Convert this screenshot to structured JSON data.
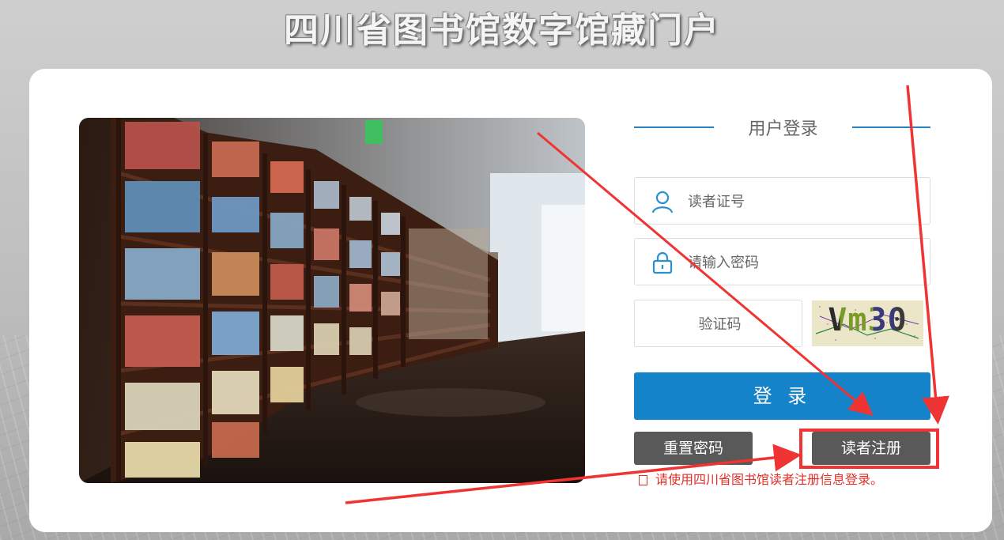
{
  "header": {
    "title": "四川省图书馆数字馆藏门户"
  },
  "login": {
    "heading": "用户登录",
    "reader_id_placeholder": "读者证号",
    "password_placeholder": "请输入密码",
    "captcha_placeholder": "验证码",
    "captcha_image_text": "Vm30",
    "login_button": "登 录",
    "reset_button": "重置密码",
    "register_button": "读者注册",
    "notice": "请使用四川省图书馆读者注册信息登录。"
  },
  "colors": {
    "accent_blue": "#1583c9",
    "secondary_button": "#595959",
    "notice_red": "#e0302a",
    "annotation_red": "#f03333"
  },
  "icons": {
    "reader_id": "user-icon",
    "password": "lock-icon"
  }
}
